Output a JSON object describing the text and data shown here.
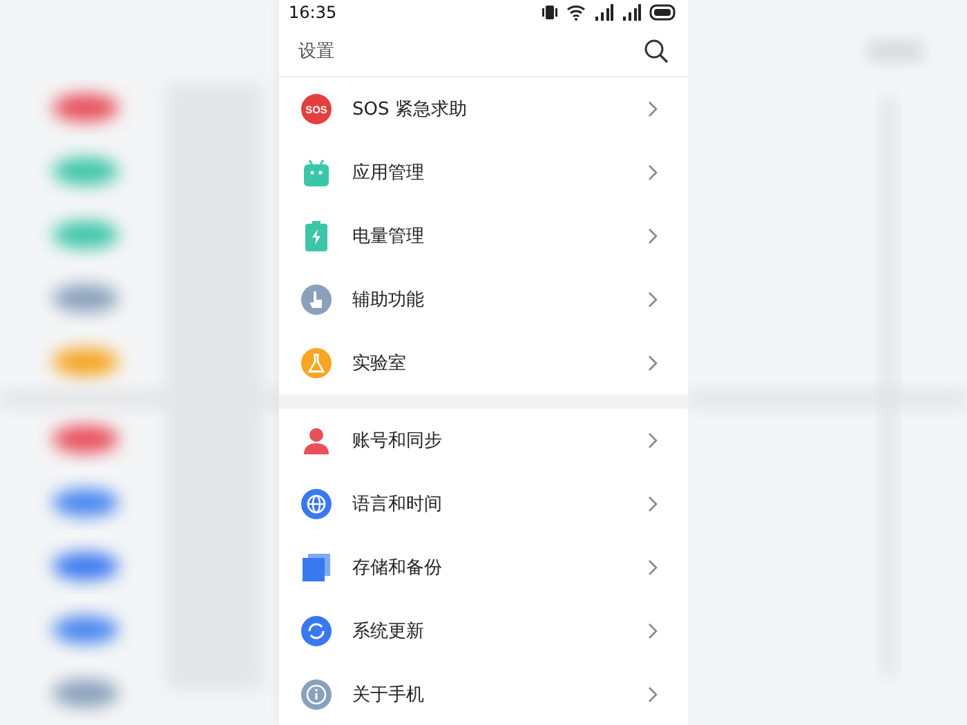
{
  "status_bar": {
    "time": "16:35"
  },
  "header": {
    "title": "设置"
  },
  "groups": [
    {
      "items": [
        {
          "kind": "sos",
          "icon_text": "SOS",
          "label": "SOS 紧急求助"
        },
        {
          "kind": "android",
          "label": "应用管理"
        },
        {
          "kind": "battery",
          "label": "电量管理"
        },
        {
          "kind": "hand",
          "label": "辅助功能"
        },
        {
          "kind": "lab",
          "label": "实验室"
        }
      ]
    },
    {
      "items": [
        {
          "kind": "person",
          "label": "账号和同步"
        },
        {
          "kind": "globe",
          "label": "语言和时间"
        },
        {
          "kind": "copy",
          "label": "存储和备份"
        },
        {
          "kind": "sync",
          "label": "系统更新"
        },
        {
          "kind": "info",
          "label": "关于手机"
        }
      ]
    }
  ]
}
